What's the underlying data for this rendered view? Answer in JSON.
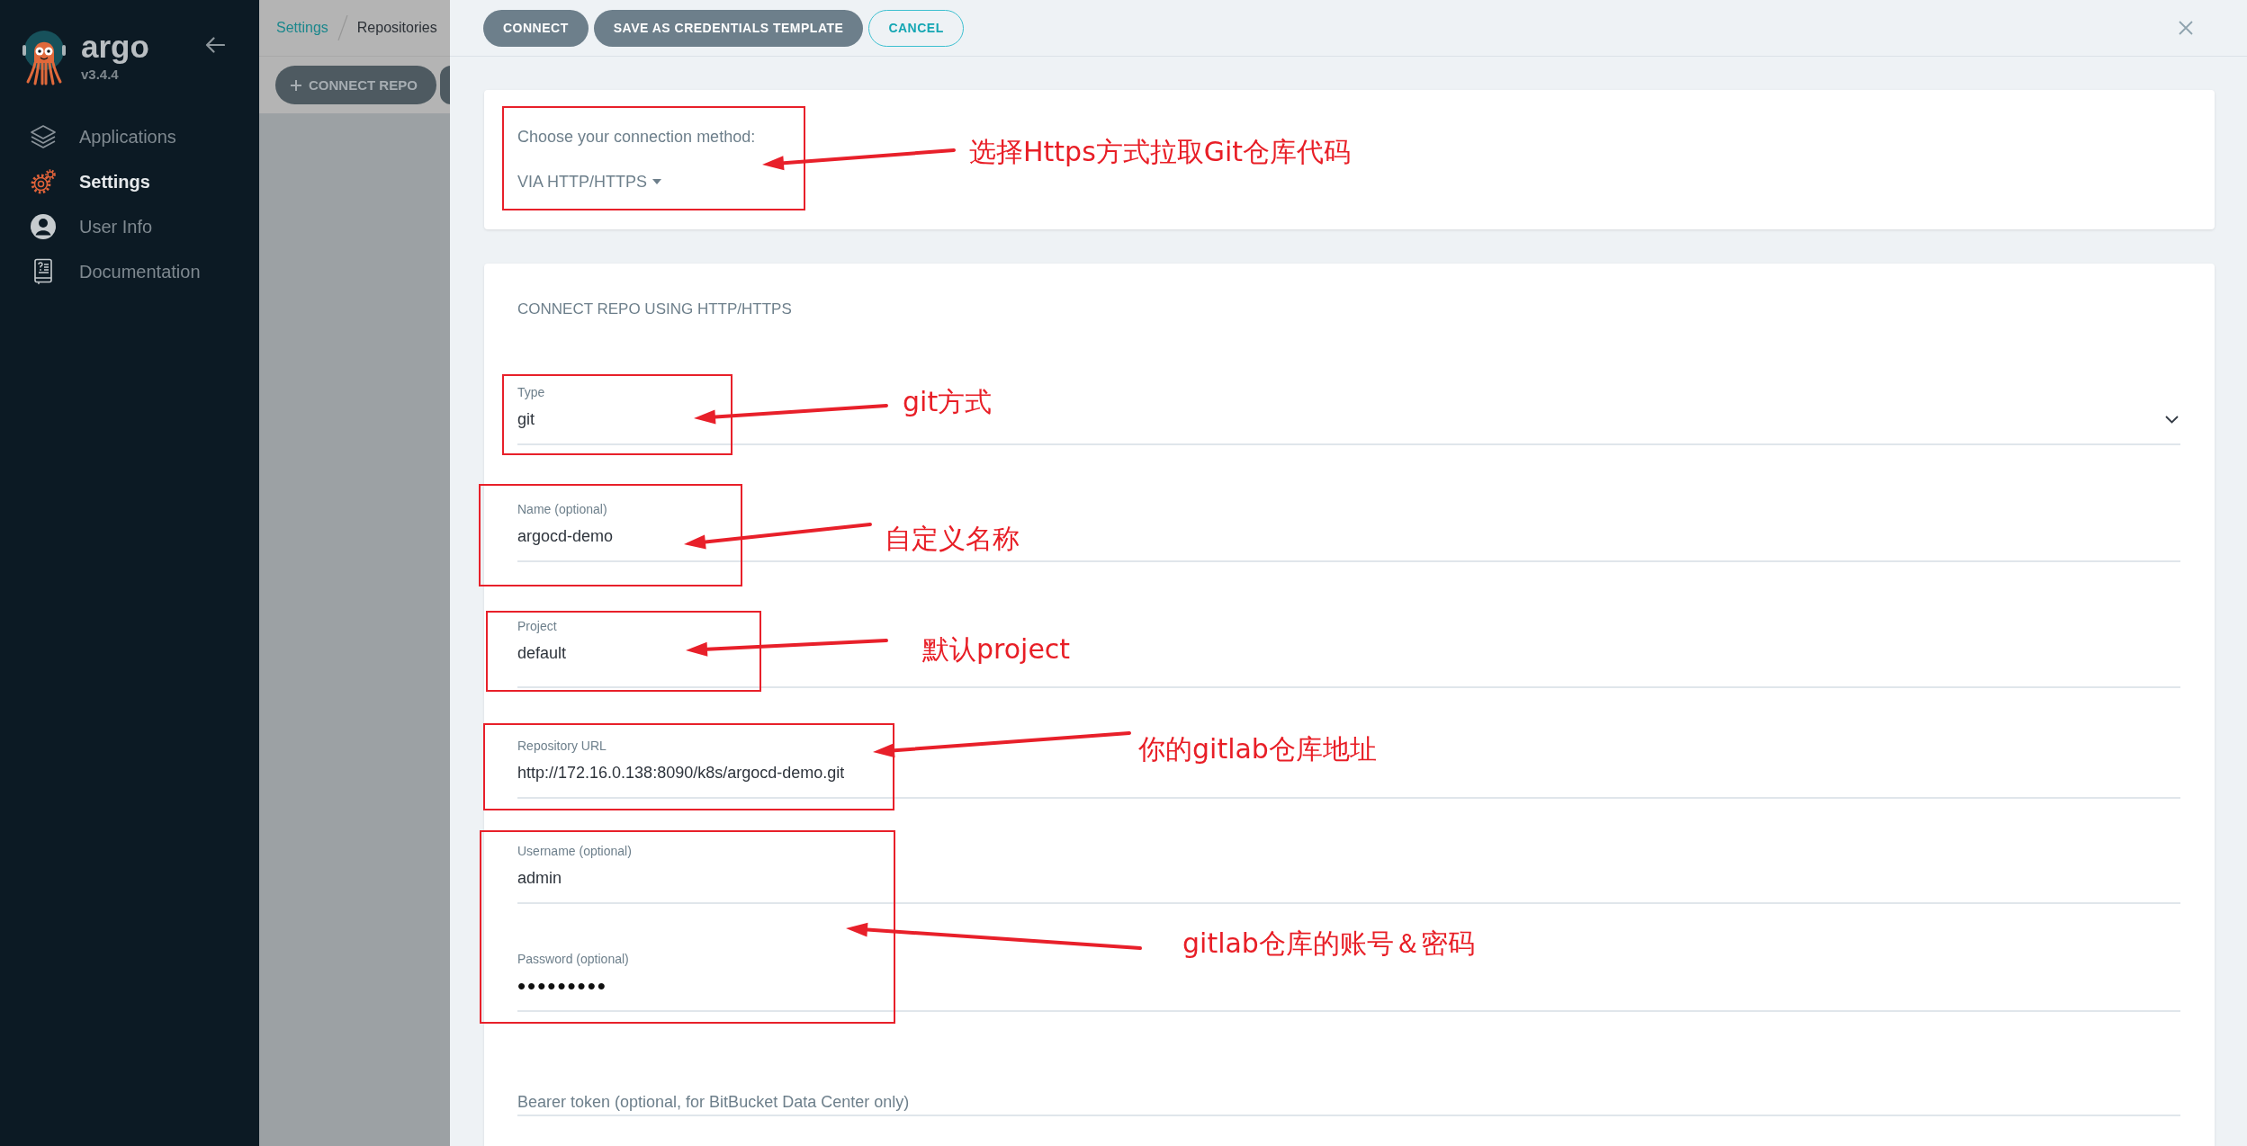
{
  "sidebar": {
    "logo_text": "argo",
    "version": "v3.4.4",
    "items": [
      {
        "label": "Applications",
        "kind": "apps",
        "selected": false
      },
      {
        "label": "Settings",
        "kind": "settings",
        "selected": true
      },
      {
        "label": "User Info",
        "kind": "user",
        "selected": false
      },
      {
        "label": "Documentation",
        "kind": "docs",
        "selected": false
      }
    ]
  },
  "background_page": {
    "breadcrumb": [
      {
        "label": "Settings",
        "kind": "link"
      },
      {
        "label": "Repositories",
        "kind": "current"
      }
    ],
    "toolbar_button": "CONNECT REPO"
  },
  "panel": {
    "buttons": [
      {
        "label": "CONNECT",
        "kind": "filled"
      },
      {
        "label": "SAVE AS CREDENTIALS TEMPLATE",
        "kind": "filled"
      },
      {
        "label": "CANCEL",
        "kind": "outline"
      }
    ],
    "connection_method": {
      "prompt": "Choose your connection method:",
      "value": "VIA HTTP/HTTPS"
    },
    "form": {
      "title": "CONNECT REPO USING HTTP/HTTPS",
      "fields": [
        {
          "kind": "select",
          "label": "Type",
          "value": "git"
        },
        {
          "kind": "text",
          "label": "Name (optional)",
          "value": "argocd-demo"
        },
        {
          "kind": "autocomplete",
          "label": "Project",
          "value": "default"
        },
        {
          "kind": "text",
          "label": "Repository URL",
          "value": "http://172.16.0.138:8090/k8s/argocd-demo.git"
        },
        {
          "kind": "text",
          "label": "Username (optional)",
          "value": "admin"
        },
        {
          "kind": "password",
          "label": "Password (optional)",
          "value": "•••••••••"
        },
        {
          "kind": "text",
          "placeholder": "Bearer token (optional, for BitBucket Data Center only)"
        }
      ]
    }
  },
  "annotations": [
    {
      "text": "选择Https方式拉取Git仓库代码"
    },
    {
      "text": "git方式"
    },
    {
      "text": "自定义名称"
    },
    {
      "text": "默认project"
    },
    {
      "text": "你的gitlab仓库地址"
    },
    {
      "text": "gitlab仓库的账号＆密码"
    }
  ]
}
